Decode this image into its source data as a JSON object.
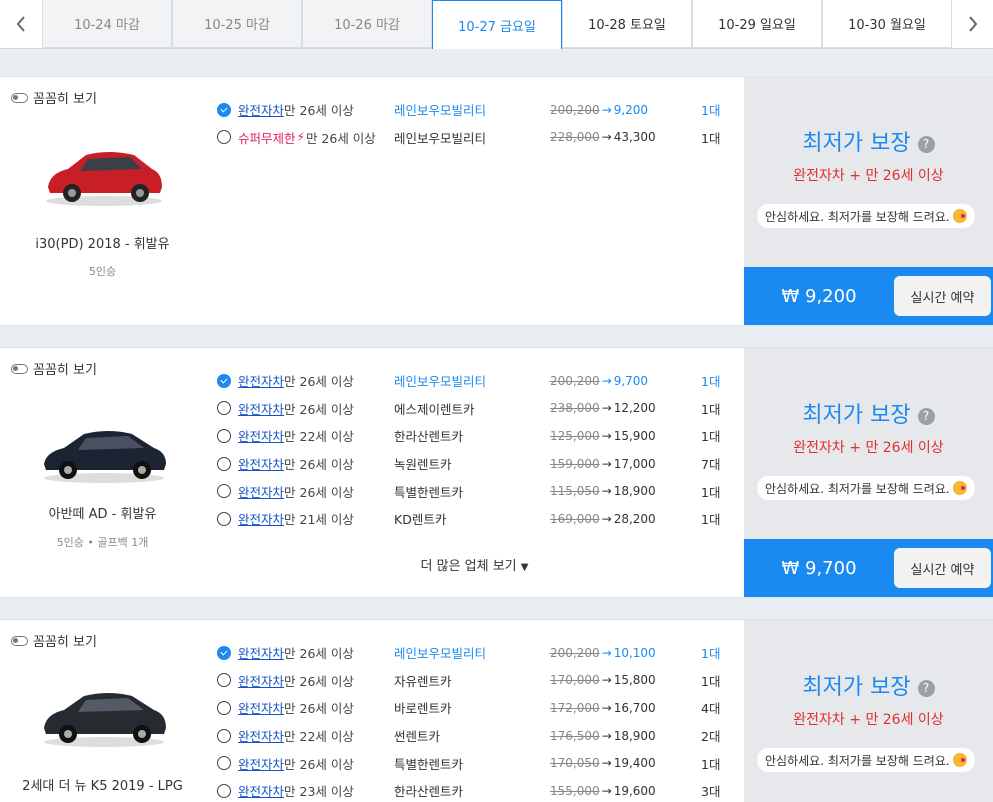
{
  "nav": {
    "prev_icon": "chevron-left-icon",
    "next_icon": "chevron-right-icon"
  },
  "tabs": [
    {
      "label": "10-24 마감",
      "state": "past"
    },
    {
      "label": "10-25 마감",
      "state": "past"
    },
    {
      "label": "10-26 마감",
      "state": "past"
    },
    {
      "label": "10-27 금요일",
      "state": "active"
    },
    {
      "label": "10-28 토요일",
      "state": "future"
    },
    {
      "label": "10-29 일요일",
      "state": "future"
    },
    {
      "label": "10-30 월요일",
      "state": "future"
    }
  ],
  "colors": {
    "accent": "#1a8af0",
    "insurance_link": "#1554c8",
    "warning": "#e03030"
  },
  "cards": [
    {
      "detail_toggle": "꼼꼼히 보기",
      "car_name": "i30(PD) 2018 - 휘발유",
      "car_spec": "5인승",
      "car_color": "#c81e28",
      "offers": [
        {
          "insurance": "완전자차",
          "age": "만 26세 이상",
          "company": "레인보우모빌리티",
          "old_price": "200,200",
          "new_price": "9,200",
          "count": "1대",
          "selected": true,
          "super": false
        },
        {
          "insurance": "슈퍼무제한",
          "age": "만 26세 이상",
          "company": "레인보우모빌리티",
          "old_price": "228,000",
          "new_price": "43,300",
          "count": "1대",
          "selected": false,
          "super": true
        }
      ],
      "more_label": "",
      "guarantee_title": "최저가 보장",
      "guarantee_sub": "완전자차 + 만 26세 이상",
      "bubble": "안심하세요. 최저가를 보장해 드려요.",
      "price": "₩ 9,200",
      "book_label": "실시간 예약"
    },
    {
      "detail_toggle": "꼼꼼히 보기",
      "car_name": "아반떼 AD - 휘발유",
      "car_spec": "5인승 • 골프백 1개",
      "car_color": "#1c2333",
      "offers": [
        {
          "insurance": "완전자차",
          "age": "만 26세 이상",
          "company": "레인보우모빌리티",
          "old_price": "200,200",
          "new_price": "9,700",
          "count": "1대",
          "selected": true,
          "super": false
        },
        {
          "insurance": "완전자차",
          "age": "만 26세 이상",
          "company": "에스제이렌트카",
          "old_price": "238,000",
          "new_price": "12,200",
          "count": "1대",
          "selected": false,
          "super": false
        },
        {
          "insurance": "완전자차",
          "age": "만 22세 이상",
          "company": "한라산렌트카",
          "old_price": "125,000",
          "new_price": "15,900",
          "count": "1대",
          "selected": false,
          "super": false
        },
        {
          "insurance": "완전자차",
          "age": "만 26세 이상",
          "company": "녹원렌트카",
          "old_price": "159,000",
          "new_price": "17,000",
          "count": "7대",
          "selected": false,
          "super": false
        },
        {
          "insurance": "완전자차",
          "age": "만 26세 이상",
          "company": "특별한렌트카",
          "old_price": "115,050",
          "new_price": "18,900",
          "count": "1대",
          "selected": false,
          "super": false
        },
        {
          "insurance": "완전자차",
          "age": "만 21세 이상",
          "company": "KD렌트카",
          "old_price": "169,000",
          "new_price": "28,200",
          "count": "1대",
          "selected": false,
          "super": false
        }
      ],
      "more_label": "더 많은 업체 보기",
      "guarantee_title": "최저가 보장",
      "guarantee_sub": "완전자차 + 만 26세 이상",
      "bubble": "안심하세요. 최저가를 보장해 드려요.",
      "price": "₩ 9,700",
      "book_label": "실시간 예약"
    },
    {
      "detail_toggle": "꼼꼼히 보기",
      "car_name": "2세대 더 뉴 K5 2019 - LPG",
      "car_spec": "",
      "car_color": "#262a31",
      "offers": [
        {
          "insurance": "완전자차",
          "age": "만 26세 이상",
          "company": "레인보우모빌리티",
          "old_price": "200,200",
          "new_price": "10,100",
          "count": "1대",
          "selected": true,
          "super": false
        },
        {
          "insurance": "완전자차",
          "age": "만 26세 이상",
          "company": "자유렌트카",
          "old_price": "170,000",
          "new_price": "15,800",
          "count": "1대",
          "selected": false,
          "super": false
        },
        {
          "insurance": "완전자차",
          "age": "만 26세 이상",
          "company": "바로렌트카",
          "old_price": "172,000",
          "new_price": "16,700",
          "count": "4대",
          "selected": false,
          "super": false
        },
        {
          "insurance": "완전자차",
          "age": "만 22세 이상",
          "company": "썬렌트카",
          "old_price": "176,500",
          "new_price": "18,900",
          "count": "2대",
          "selected": false,
          "super": false
        },
        {
          "insurance": "완전자차",
          "age": "만 26세 이상",
          "company": "특별한렌트카",
          "old_price": "170,050",
          "new_price": "19,400",
          "count": "1대",
          "selected": false,
          "super": false
        },
        {
          "insurance": "완전자차",
          "age": "만 23세 이상",
          "company": "한라산렌트카",
          "old_price": "155,000",
          "new_price": "19,600",
          "count": "3대",
          "selected": false,
          "super": false
        }
      ],
      "more_label": "",
      "guarantee_title": "최저가 보장",
      "guarantee_sub": "완전자차 + 만 26세 이상",
      "bubble": "안심하세요. 최저가를 보장해 드려요.",
      "price": "",
      "book_label": ""
    }
  ]
}
